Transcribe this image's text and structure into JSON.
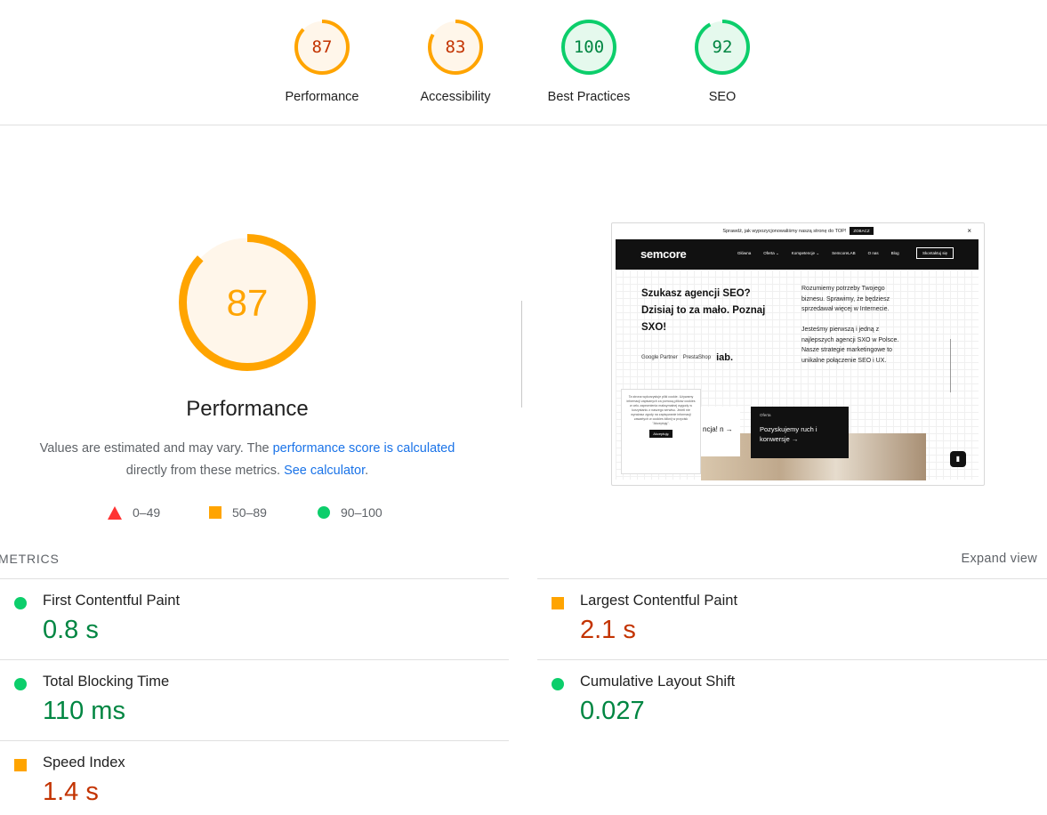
{
  "gauges": [
    {
      "label": "Performance",
      "score": "87",
      "status": "average"
    },
    {
      "label": "Accessibility",
      "score": "83",
      "status": "average"
    },
    {
      "label": "Best Practices",
      "score": "100",
      "status": "pass"
    },
    {
      "label": "SEO",
      "score": "92",
      "status": "pass"
    }
  ],
  "colors": {
    "pass": "#0cce6b",
    "pass_text": "#018642",
    "pass_bg": "#e5f9ed",
    "average": "#ffa400",
    "average_text": "#c33300",
    "average_bg": "#fff6ea",
    "fail": "#ff3333"
  },
  "performance": {
    "score": "87",
    "title": "Performance",
    "desc_prefix": "Values are estimated and may vary. The ",
    "desc_link1": "performance score is calculated",
    "desc_middle": " directly from these metrics. ",
    "desc_link2": "See calculator",
    "desc_suffix": "."
  },
  "legend": [
    {
      "shape": "triangle-icon",
      "range": "0–49"
    },
    {
      "shape": "square-icon",
      "range": "50–89"
    },
    {
      "shape": "circle-icon",
      "range": "90–100"
    }
  ],
  "screenshot": {
    "topbar_text": "Sprawdź, jak wypozycjonowaliśmy naszą stronę do TOP!",
    "topbar_button": "ZOBACZ",
    "close": "×",
    "logo": "semcore",
    "nav": [
      "Główna",
      "Oferta ⌄",
      "Kompetencje ⌄",
      "SemcoreLAB",
      "O nas",
      "Blog"
    ],
    "nav_button": "Skontaktuj się",
    "headline": "Szukasz agencji SEO? Dzisiaj to za mało. Poznaj SXO!",
    "para1": "Rozumiemy potrzeby Twojego biznesu. Sprawimy, że będziesz sprzedawał więcej w Internecie.",
    "para2": "Jesteśmy pierwszą i jedną z najlepszych agencji SXO w Polsce. Nasze strategie marketingowe to unikalne połączenie SEO i UX.",
    "logos": [
      "Google Partner",
      "PrestaShop",
      "iab."
    ],
    "cookie_text": "Ta strona wykorzystuje pliki cookie. Używamy informacji zapisanych za pomocą plików cookies w celu zapewnienia maksymalnej wygody w korzystaniu z naszego serwisu. Jeżeli nie wyrażasz zgody na zapisywanie informacji zawartych w cookies kliknij w przycisk \"Akceptuję\".",
    "cookie_button": "Akceptuję",
    "card1": "ncja! n →",
    "card2_small": "Oferta",
    "card2_big": "Pozyskujemy ruch i konwersje →",
    "chat_icon": "chat-icon"
  },
  "metrics": {
    "title": "METRICS",
    "expand_label": "Expand view",
    "items": [
      {
        "name": "First Contentful Paint",
        "value": "0.8 s",
        "status": "pass"
      },
      {
        "name": "Largest Contentful Paint",
        "value": "2.1 s",
        "status": "average"
      },
      {
        "name": "Total Blocking Time",
        "value": "110 ms",
        "status": "pass"
      },
      {
        "name": "Cumulative Layout Shift",
        "value": "0.027",
        "status": "pass"
      },
      {
        "name": "Speed Index",
        "value": "1.4 s",
        "status": "average"
      }
    ]
  }
}
